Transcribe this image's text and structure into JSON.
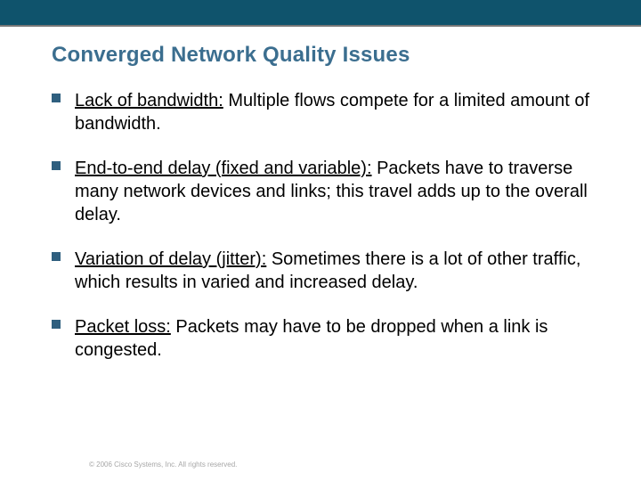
{
  "title": "Converged Network Quality Issues",
  "bullets": [
    {
      "term": "Lack of bandwidth:",
      "rest": " Multiple flows compete for a limited amount of bandwidth."
    },
    {
      "term": "End-to-end delay (fixed and variable):",
      "rest": " Packets have to traverse many network devices and links; this travel adds up to the overall delay."
    },
    {
      "term": "Variation of delay (jitter):",
      "rest": " Sometimes there is a lot of other traffic, which results in varied and increased delay."
    },
    {
      "term": "Packet loss:",
      "rest": " Packets may have to be dropped when a link is congested."
    }
  ],
  "footer": "© 2006 Cisco Systems, Inc. All rights reserved."
}
